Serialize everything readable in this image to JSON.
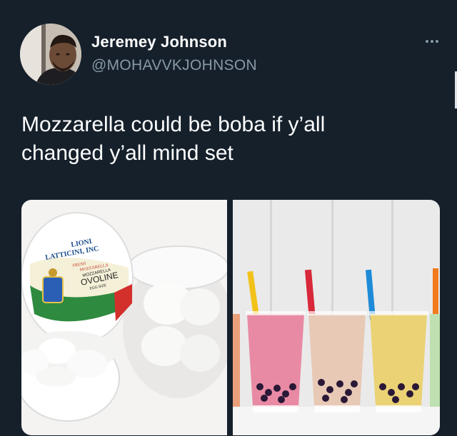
{
  "tweet": {
    "author_name": "Jeremey Johnson",
    "author_handle": "@MOHAVVKJOHNSON",
    "text_line1": "Mozzarella could be boba if y’all",
    "text_line2": "changed y’all mind set",
    "more_icon": "more-horizontal-icon"
  },
  "media": {
    "left_label": {
      "brand_line1": "LIONI",
      "brand_line2": "LATTICINI, INC",
      "fresh": "FRESH",
      "mozz": "MOZZARELLA",
      "product_small": "MOZZARELLA",
      "product": "OVOLINE",
      "size": "EGG SIZE"
    },
    "colors": {
      "background": "#15202b",
      "handle": "#8899a6",
      "tea_pink": "#e98aa4",
      "tea_milk": "#e7c9b5",
      "tea_yellow": "#ead275",
      "straw_yellow": "#f2c21a",
      "straw_red": "#d8283a",
      "straw_blue": "#1e8bd8",
      "straw_orange": "#f07a1c"
    }
  }
}
